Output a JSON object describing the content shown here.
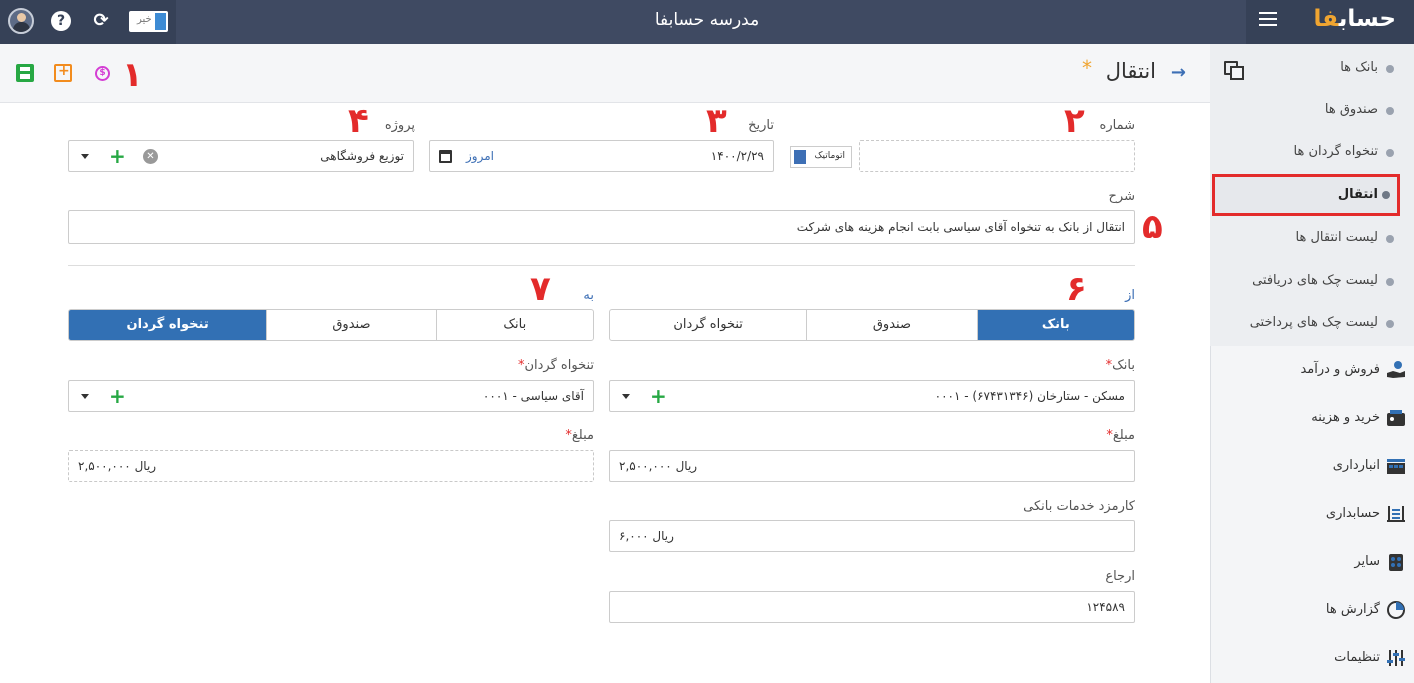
{
  "app": {
    "title": "مدرسه حسابفا",
    "logo_main": "حساب",
    "logo_accent": "فا",
    "toggle_label": "خیر"
  },
  "toolbar": {
    "page_title": "انتقال",
    "title_star": "*",
    "back_arrow": "→",
    "money_icon_glyph": "$"
  },
  "annotations": [
    "۱",
    "۲",
    "۳",
    "۴",
    "۵",
    "۶",
    "۷"
  ],
  "sidebar": {
    "sub_items": [
      {
        "label": "بانک ها"
      },
      {
        "label": "صندوق ها"
      },
      {
        "label": "تنخواه گردان ها"
      },
      {
        "label": "انتقال"
      },
      {
        "label": "لیست انتقال ها"
      },
      {
        "label": "لیست چک های دریافتی"
      },
      {
        "label": "لیست چک های پرداختی"
      }
    ],
    "main_items": [
      {
        "label": "فروش و درآمد",
        "icon": "hand-money-icon"
      },
      {
        "label": "خرید و هزینه",
        "icon": "wallet-icon"
      },
      {
        "label": "انبارداری",
        "icon": "warehouse-icon"
      },
      {
        "label": "حسابداری",
        "icon": "abacus-icon"
      },
      {
        "label": "سایر",
        "icon": "grid-icon"
      },
      {
        "label": "گزارش ها",
        "icon": "pie-chart-icon"
      },
      {
        "label": "تنظیمات",
        "icon": "sliders-icon"
      }
    ]
  },
  "form": {
    "number": {
      "label": "شماره",
      "value": ""
    },
    "auto_label": "اتوماتیک",
    "date": {
      "label": "تاریخ",
      "value": "۱۴۰۰/۲/۲۹",
      "today": "امروز"
    },
    "project": {
      "label": "پروژه",
      "value": "توزیع فروشگاهی"
    },
    "description": {
      "label": "شرح",
      "value": "انتقال از بانک به تنخواه  آقای سیاسی بابت انجام هزینه های شرکت"
    },
    "from": {
      "label": "از",
      "options": [
        "بانک",
        "صندوق",
        "تنخواه گردان"
      ],
      "selected": 0,
      "account_label": "بانک",
      "account_value": "۰۰۰۱ - مسکن - ستارخان (۶۷۴۳۱۳۴۶)",
      "amount_label": "مبلغ",
      "amount_value": "ریال ۲,۵۰۰,۰۰۰",
      "fee_label": "کارمزد خدمات بانکی",
      "fee_value": "ریال ۶,۰۰۰",
      "ref_label": "ارجاع",
      "ref_value": "۱۲۴۵۸۹"
    },
    "to": {
      "label": "به",
      "options": [
        "بانک",
        "صندوق",
        "تنخواه گردان"
      ],
      "selected": 2,
      "account_label": "تنخواه گردان",
      "account_value": "۰۰۰۱ - آقای سیاسی",
      "amount_label": "مبلغ",
      "amount_value": "ریال ۲,۵۰۰,۰۰۰"
    },
    "required_mark": "*"
  },
  "colors": {
    "topbar": "#3f4a62",
    "primary": "#3270b4",
    "annotation": "#e32b2b",
    "accent": "#f0a531"
  }
}
